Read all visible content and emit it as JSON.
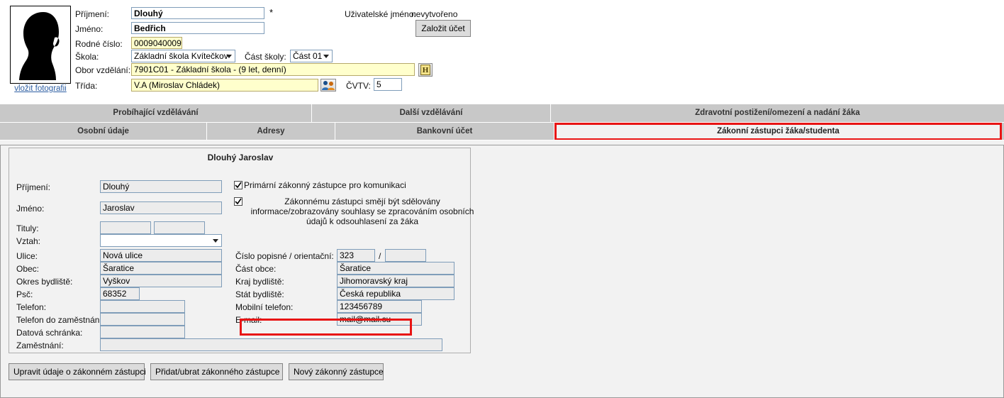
{
  "header": {
    "photo_link": "vložit fotografii",
    "avatar_icon": "person-silhouette-icon",
    "fields": [
      {
        "label": "Příjmení:",
        "value": "Dlouhý",
        "required_mark": "*"
      },
      {
        "label": "Jméno:",
        "value": "Bedřich"
      },
      {
        "label": "Rodné číslo:",
        "value": "0009040009"
      },
      {
        "label": "Škola:",
        "value": "Základní škola Kvítečkov"
      },
      {
        "label": "Část školy:",
        "value": "Část 01"
      },
      {
        "label": "Obor vzdělání:",
        "value": "7901C01 - Základní škola -  (9 let, denní)"
      },
      {
        "label": "Třída:",
        "value": "V.A (Miroslav Chládek)"
      },
      {
        "label": "ČVTV:",
        "value": "5"
      }
    ],
    "username_label": "Uživatelské jméno:",
    "username_value": "nevytvořeno",
    "create_account_button": "Založit účet",
    "history_icon": "history-h-icon",
    "history_icon_text": "H",
    "class_icon": "people-group-icon"
  },
  "tabs": {
    "row1": [
      {
        "label": "Probíhající vzdělávání",
        "selected": false
      },
      {
        "label": "Další vzdělávání",
        "selected": false
      },
      {
        "label": "Zdravotní postižení/omezení a nadání žáka",
        "selected": false
      }
    ],
    "row2": [
      {
        "label": "Osobní údaje",
        "selected": false
      },
      {
        "label": "Adresy",
        "selected": false
      },
      {
        "label": "Bankovní účet",
        "selected": false
      },
      {
        "label": "Zákonní zástupci žáka/studenta",
        "selected": true
      }
    ]
  },
  "guardian": {
    "title": "Dlouhý Jaroslav",
    "checkbox_primary": {
      "label": "Primární zákonný zástupce pro komunikaci",
      "checked": true
    },
    "checkbox_consent": {
      "label": "Zákonnému zástupci smějí být sdělovány informace/zobrazovány souhlasy se zpracováním osobních údajů k odsouhlasení za žáka",
      "checked": true
    },
    "left_fields": [
      {
        "label": "Příjmení:",
        "value": "Dlouhý"
      },
      {
        "label": "Jméno:",
        "value": "Jaroslav"
      },
      {
        "label": "Tituly:",
        "value": ""
      },
      {
        "label": "Tituly2:",
        "value": ""
      },
      {
        "label": "Vztah:",
        "value": ""
      },
      {
        "label": "Ulice:",
        "value": "Nová ulice"
      },
      {
        "label": "Obec:",
        "value": "Šaratice"
      },
      {
        "label": "Okres bydliště:",
        "value": "Vyškov"
      },
      {
        "label": "Psč:",
        "value": "68352"
      },
      {
        "label": "Telefon:",
        "value": ""
      },
      {
        "label": "Telefon do zaměstnání:",
        "value": ""
      },
      {
        "label": "Datová schránka:",
        "value": ""
      },
      {
        "label": "Zaměstnání:",
        "value": ""
      }
    ],
    "right_fields": [
      {
        "label": "Číslo popisné / orientační:",
        "value": "323",
        "value2": "",
        "separator": "/"
      },
      {
        "label": "Část obce:",
        "value": "Šaratice"
      },
      {
        "label": "Kraj bydliště:",
        "value": "Jihomoravský kraj"
      },
      {
        "label": "Stát bydliště:",
        "value": "Česká republika"
      },
      {
        "label": "Mobilní telefon:",
        "value": "123456789"
      },
      {
        "label": "E-mail:",
        "value": "mail@mail.cu"
      }
    ]
  },
  "actions": [
    {
      "label": "Upravit údaje o zákonném zástupci"
    },
    {
      "label": "Přidat/ubrat zákonného zástupce"
    },
    {
      "label": "Nový zákonný zástupce"
    }
  ],
  "colors": {
    "highlight_red": "#e81414",
    "tab_bar": "#c8c8c8",
    "panel_bg": "#f2f2f2",
    "field_border": "#7f9db9",
    "readonly_field_bg": "#ececec",
    "yellow_field_bg": "#ffffcc",
    "link_blue": "#2e5fa3"
  }
}
